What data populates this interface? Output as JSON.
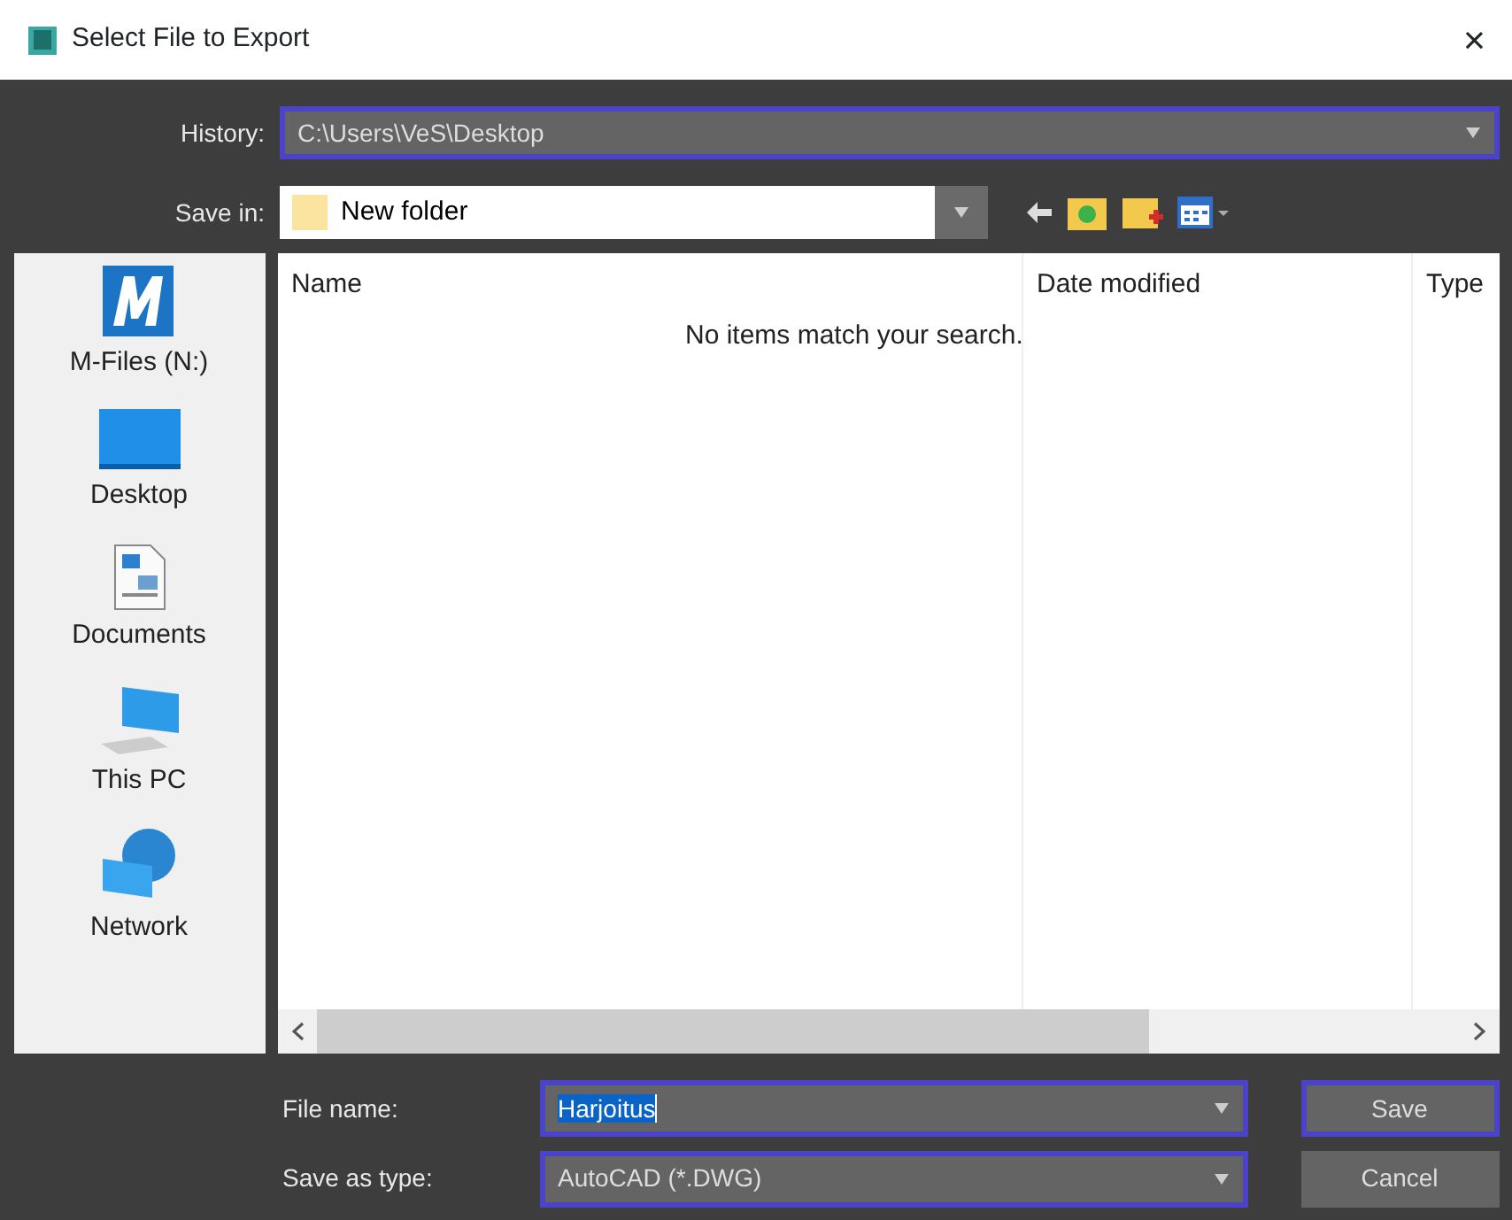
{
  "window": {
    "title": "Select File to Export",
    "close": "×"
  },
  "history": {
    "label": "History:",
    "value": "C:\\Users\\VeS\\Desktop"
  },
  "save_in": {
    "label": "Save in:",
    "value": "New folder"
  },
  "places": [
    {
      "label": "M-Files (N:)",
      "kind": "mfiles"
    },
    {
      "label": "Desktop",
      "kind": "desktop"
    },
    {
      "label": "Documents",
      "kind": "documents"
    },
    {
      "label": "This PC",
      "kind": "pc"
    },
    {
      "label": "Network",
      "kind": "network"
    }
  ],
  "file_list": {
    "columns": [
      "Name",
      "Date modified",
      "Type"
    ],
    "empty_message": "No items match your search."
  },
  "file_name": {
    "label": "File name:",
    "value": "Harjoitus",
    "selected": true
  },
  "save_as_type": {
    "label": "Save as type:",
    "value": "AutoCAD (*.DWG)"
  },
  "buttons": [
    {
      "label": "Save",
      "focused": true
    },
    {
      "label": "Cancel",
      "focused": false
    }
  ]
}
